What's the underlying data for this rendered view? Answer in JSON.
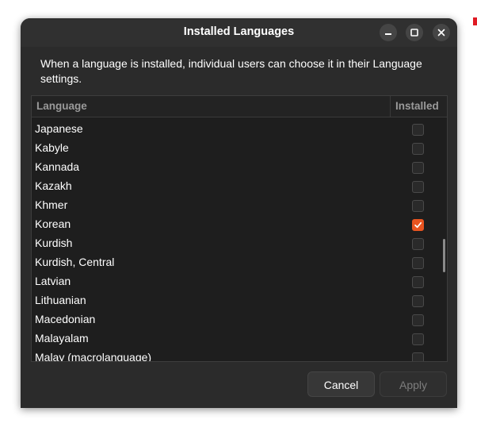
{
  "window": {
    "title": "Installed Languages"
  },
  "description": "When a language is installed, individual users can choose it in their Language settings.",
  "table": {
    "columns": [
      "Language",
      "Installed"
    ],
    "rows": [
      {
        "label": "Japanese",
        "installed": false
      },
      {
        "label": "Kabyle",
        "installed": false
      },
      {
        "label": "Kannada",
        "installed": false
      },
      {
        "label": "Kazakh",
        "installed": false
      },
      {
        "label": "Khmer",
        "installed": false
      },
      {
        "label": "Korean",
        "installed": true
      },
      {
        "label": "Kurdish",
        "installed": false
      },
      {
        "label": "Kurdish, Central",
        "installed": false
      },
      {
        "label": "Latvian",
        "installed": false
      },
      {
        "label": "Lithuanian",
        "installed": false
      },
      {
        "label": "Macedonian",
        "installed": false
      },
      {
        "label": "Malayalam",
        "installed": false
      },
      {
        "label": "Malay (macrolanguage)",
        "installed": false
      }
    ]
  },
  "buttons": {
    "cancel": "Cancel",
    "apply": "Apply"
  },
  "colors": {
    "accent": "#e95420",
    "background": "#2b2b2b"
  },
  "icons": {
    "minimize": "minimize-icon",
    "maximize": "maximize-icon",
    "close": "close-icon",
    "check": "checkmark-icon"
  }
}
